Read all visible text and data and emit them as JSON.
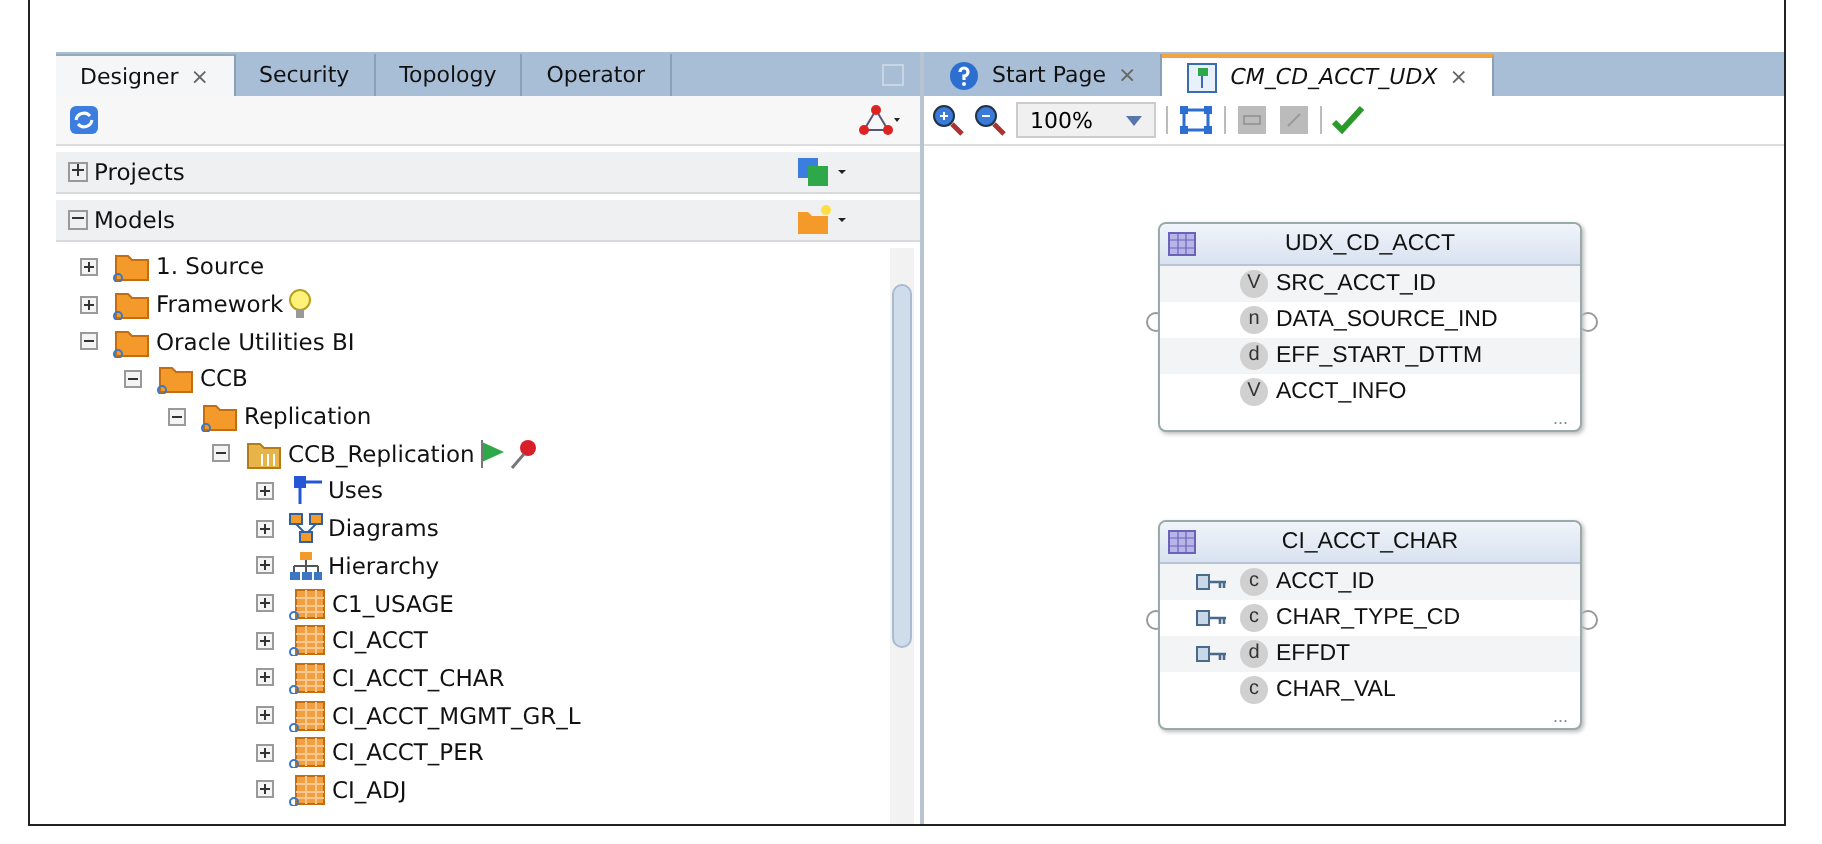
{
  "left_panel": {
    "tabs": [
      {
        "label": "Designer",
        "selected": true,
        "close": "×"
      },
      {
        "label": "Security",
        "selected": false
      },
      {
        "label": "Topology",
        "selected": false
      },
      {
        "label": "Operator",
        "selected": false
      }
    ],
    "sections": [
      {
        "label": "Projects",
        "expanded": false,
        "kind": "projects"
      },
      {
        "label": "Models",
        "expanded": true,
        "kind": "models"
      }
    ],
    "tree": [
      {
        "label": "1. Source",
        "kind": "folder",
        "expanded": false
      },
      {
        "label": "Framework",
        "kind": "folder",
        "expanded": false,
        "badges": [
          {
            "kind": "bulb"
          }
        ]
      },
      {
        "label": "Oracle Utilities BI",
        "kind": "folder",
        "expanded": true,
        "children": [
          {
            "label": "CCB",
            "kind": "folder",
            "expanded": true,
            "children": [
              {
                "label": "Replication",
                "kind": "folder",
                "expanded": true,
                "children": [
                  {
                    "label": "CCB_Replication",
                    "kind": "model",
                    "expanded": true,
                    "badges": [
                      {
                        "kind": "flag"
                      },
                      {
                        "kind": "pin"
                      }
                    ],
                    "children": [
                      {
                        "label": "Uses",
                        "kind": "uses",
                        "expanded": false
                      },
                      {
                        "label": "Diagrams",
                        "kind": "diagrams",
                        "expanded": false
                      },
                      {
                        "label": "Hierarchy",
                        "kind": "hierarchy",
                        "expanded": false
                      },
                      {
                        "label": "C1_USAGE",
                        "kind": "table",
                        "expanded": false
                      },
                      {
                        "label": "CI_ACCT",
                        "kind": "table",
                        "expanded": false
                      },
                      {
                        "label": "CI_ACCT_CHAR",
                        "kind": "table",
                        "expanded": false
                      },
                      {
                        "label": "CI_ACCT_MGMT_GR_L",
                        "kind": "table",
                        "expanded": false
                      },
                      {
                        "label": "CI_ACCT_PER",
                        "kind": "table",
                        "expanded": false
                      },
                      {
                        "label": "CI_ADJ",
                        "kind": "table",
                        "expanded": false
                      }
                    ]
                  }
                ]
              }
            ]
          }
        ]
      }
    ]
  },
  "right_panel": {
    "tabs": [
      {
        "label": "Start Page",
        "selected": false,
        "kind": "help",
        "close": "×"
      },
      {
        "label": "CM_CD_ACCT_UDX",
        "selected": true,
        "kind": "diagram",
        "close": "×"
      }
    ],
    "zoom": {
      "value": "100%"
    },
    "entities": [
      {
        "title": "UDX_CD_ACCT",
        "more": "...",
        "columns": [
          {
            "type": "V",
            "name": "SRC_ACCT_ID",
            "key": false
          },
          {
            "type": "n",
            "name": "DATA_SOURCE_IND",
            "key": false
          },
          {
            "type": "d",
            "name": "EFF_START_DTTM",
            "key": false
          },
          {
            "type": "V",
            "name": "ACCT_INFO",
            "key": false
          }
        ]
      },
      {
        "title": "CI_ACCT_CHAR",
        "more": "...",
        "columns": [
          {
            "type": "c",
            "name": "ACCT_ID",
            "key": true
          },
          {
            "type": "c",
            "name": "CHAR_TYPE_CD",
            "key": true
          },
          {
            "type": "d",
            "name": "EFFDT",
            "key": true
          },
          {
            "type": "c",
            "name": "CHAR_VAL",
            "key": false
          }
        ]
      }
    ]
  }
}
